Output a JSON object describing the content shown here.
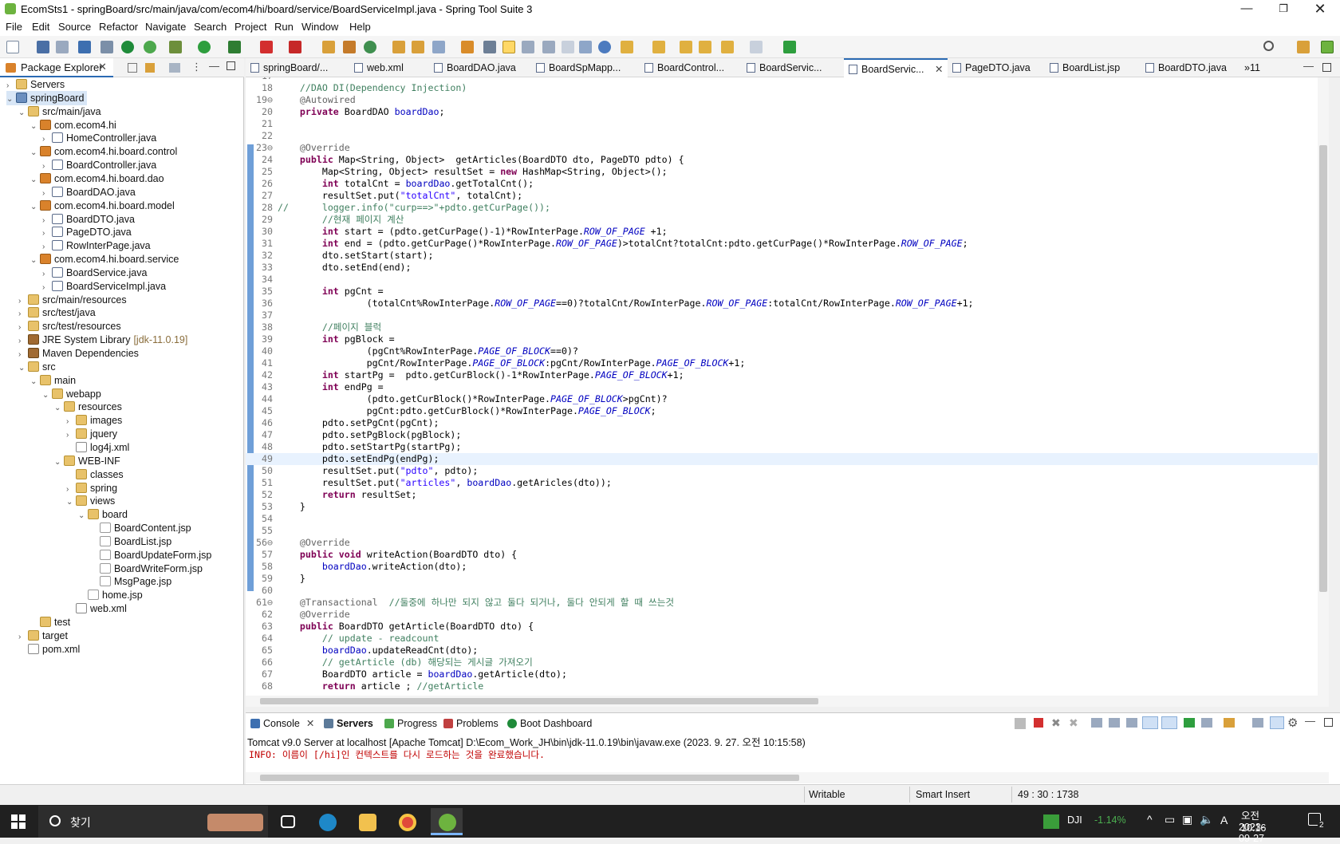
{
  "window": {
    "title": "EcomSts1 - springBoard/src/main/java/com/ecom4/hi/board/service/BoardServiceImpl.java - Spring Tool Suite 3"
  },
  "menu": [
    "File",
    "Edit",
    "Source",
    "Refactor",
    "Navigate",
    "Search",
    "Project",
    "Run",
    "Window",
    "Help"
  ],
  "package_explorer": {
    "title": "Package Explorer",
    "tree": [
      {
        "label": "Servers",
        "depth": 0,
        "icon": "folder",
        "arrow": "›"
      },
      {
        "label": "springBoard",
        "depth": 0,
        "icon": "project",
        "arrow": "⌄",
        "selected": true
      },
      {
        "label": "src/main/java",
        "depth": 1,
        "icon": "folder",
        "arrow": "⌄"
      },
      {
        "label": "com.ecom4.hi",
        "depth": 2,
        "icon": "pkg",
        "arrow": "⌄"
      },
      {
        "label": "HomeController.java",
        "depth": 3,
        "icon": "java",
        "arrow": "›"
      },
      {
        "label": "com.ecom4.hi.board.control",
        "depth": 2,
        "icon": "pkg",
        "arrow": "⌄"
      },
      {
        "label": "BoardController.java",
        "depth": 3,
        "icon": "java",
        "arrow": "›"
      },
      {
        "label": "com.ecom4.hi.board.dao",
        "depth": 2,
        "icon": "pkg",
        "arrow": "⌄"
      },
      {
        "label": "BoardDAO.java",
        "depth": 3,
        "icon": "java",
        "arrow": "›"
      },
      {
        "label": "com.ecom4.hi.board.model",
        "depth": 2,
        "icon": "pkg",
        "arrow": "⌄"
      },
      {
        "label": "BoardDTO.java",
        "depth": 3,
        "icon": "java",
        "arrow": "›"
      },
      {
        "label": "PageDTO.java",
        "depth": 3,
        "icon": "java",
        "arrow": "›"
      },
      {
        "label": "RowInterPage.java",
        "depth": 3,
        "icon": "java",
        "arrow": "›"
      },
      {
        "label": "com.ecom4.hi.board.service",
        "depth": 2,
        "icon": "pkg",
        "arrow": "⌄"
      },
      {
        "label": "BoardService.java",
        "depth": 3,
        "icon": "java",
        "arrow": "›"
      },
      {
        "label": "BoardServiceImpl.java",
        "depth": 3,
        "icon": "java",
        "arrow": "›"
      },
      {
        "label": "src/main/resources",
        "depth": 1,
        "icon": "folder",
        "arrow": "›"
      },
      {
        "label": "src/test/java",
        "depth": 1,
        "icon": "folder",
        "arrow": "›"
      },
      {
        "label": "src/test/resources",
        "depth": 1,
        "icon": "folder",
        "arrow": "›"
      },
      {
        "label": "JRE System Library",
        "suffix": "[jdk-11.0.19]",
        "depth": 1,
        "icon": "lib",
        "arrow": "›"
      },
      {
        "label": "Maven Dependencies",
        "depth": 1,
        "icon": "lib",
        "arrow": "›"
      },
      {
        "label": "src",
        "depth": 1,
        "icon": "folder",
        "arrow": "⌄"
      },
      {
        "label": "main",
        "depth": 2,
        "icon": "folder",
        "arrow": "⌄"
      },
      {
        "label": "webapp",
        "depth": 3,
        "icon": "folder",
        "arrow": "⌄"
      },
      {
        "label": "resources",
        "depth": 4,
        "icon": "folder",
        "arrow": "⌄"
      },
      {
        "label": "images",
        "depth": 5,
        "icon": "folder",
        "arrow": "›"
      },
      {
        "label": "jquery",
        "depth": 5,
        "icon": "folder",
        "arrow": "›"
      },
      {
        "label": "log4j.xml",
        "depth": 5,
        "icon": "xml",
        "arrow": ""
      },
      {
        "label": "WEB-INF",
        "depth": 4,
        "icon": "folder",
        "arrow": "⌄"
      },
      {
        "label": "classes",
        "depth": 5,
        "icon": "folder",
        "arrow": ""
      },
      {
        "label": "spring",
        "depth": 5,
        "icon": "folder",
        "arrow": "›"
      },
      {
        "label": "views",
        "depth": 5,
        "icon": "folder",
        "arrow": "⌄"
      },
      {
        "label": "board",
        "depth": 6,
        "icon": "folder",
        "arrow": "⌄"
      },
      {
        "label": "BoardContent.jsp",
        "depth": 7,
        "icon": "jsp",
        "arrow": ""
      },
      {
        "label": "BoardList.jsp",
        "depth": 7,
        "icon": "jsp",
        "arrow": ""
      },
      {
        "label": "BoardUpdateForm.jsp",
        "depth": 7,
        "icon": "jsp",
        "arrow": ""
      },
      {
        "label": "BoardWriteForm.jsp",
        "depth": 7,
        "icon": "jsp",
        "arrow": ""
      },
      {
        "label": "MsgPage.jsp",
        "depth": 7,
        "icon": "jsp",
        "arrow": ""
      },
      {
        "label": "home.jsp",
        "depth": 6,
        "icon": "jsp",
        "arrow": ""
      },
      {
        "label": "web.xml",
        "depth": 5,
        "icon": "xml",
        "arrow": ""
      },
      {
        "label": "test",
        "depth": 2,
        "icon": "folder",
        "arrow": ""
      },
      {
        "label": "target",
        "depth": 1,
        "icon": "folder",
        "arrow": "›"
      },
      {
        "label": "pom.xml",
        "depth": 1,
        "icon": "xml",
        "arrow": ""
      }
    ]
  },
  "editor_tabs": [
    {
      "label": "springBoard/..."
    },
    {
      "label": "web.xml"
    },
    {
      "label": "BoardDAO.java"
    },
    {
      "label": "BoardSpMapp..."
    },
    {
      "label": "BoardControl..."
    },
    {
      "label": "BoardServic..."
    },
    {
      "label": "BoardServic...",
      "active": true
    },
    {
      "label": "PageDTO.java"
    },
    {
      "label": "BoardList.jsp"
    },
    {
      "label": "BoardDTO.java"
    },
    {
      "label": "»11"
    }
  ],
  "code_lines": [
    {
      "n": "17",
      "t": ""
    },
    {
      "n": "18",
      "t": "    //DAO DI(Dependency Injection)"
    },
    {
      "n": "19⊖",
      "t": "    @Autowired"
    },
    {
      "n": "20",
      "t": "    private BoardDAO boardDao;"
    },
    {
      "n": "21",
      "t": ""
    },
    {
      "n": "22",
      "t": ""
    },
    {
      "n": "23⊖",
      "t": "    @Override"
    },
    {
      "n": "24",
      "t": "    public Map<String, Object>  getArticles(BoardDTO dto, PageDTO pdto) {"
    },
    {
      "n": "25",
      "t": "        Map<String, Object> resultSet = new HashMap<String, Object>();"
    },
    {
      "n": "26",
      "t": "        int totalCnt = boardDao.getTotalCnt();"
    },
    {
      "n": "27",
      "t": "        resultSet.put(\"totalCnt\", totalCnt);"
    },
    {
      "n": "28",
      "t": "//      logger.info(\"curp==>\"+pdto.getCurPage());"
    },
    {
      "n": "29",
      "t": "        //현재 페이지 계산"
    },
    {
      "n": "30",
      "t": "        int start = (pdto.getCurPage()-1)*RowInterPage.ROW_OF_PAGE +1;"
    },
    {
      "n": "31",
      "t": "        int end = (pdto.getCurPage()*RowInterPage.ROW_OF_PAGE)>totalCnt?totalCnt:pdto.getCurPage()*RowInterPage.ROW_OF_PAGE;"
    },
    {
      "n": "32",
      "t": "        dto.setStart(start);"
    },
    {
      "n": "33",
      "t": "        dto.setEnd(end);"
    },
    {
      "n": "34",
      "t": ""
    },
    {
      "n": "35",
      "t": "        int pgCnt ="
    },
    {
      "n": "36",
      "t": "                (totalCnt%RowInterPage.ROW_OF_PAGE==0)?totalCnt/RowInterPage.ROW_OF_PAGE:totalCnt/RowInterPage.ROW_OF_PAGE+1;"
    },
    {
      "n": "37",
      "t": ""
    },
    {
      "n": "38",
      "t": "        //페이지 블럭"
    },
    {
      "n": "39",
      "t": "        int pgBlock ="
    },
    {
      "n": "40",
      "t": "                (pgCnt%RowInterPage.PAGE_OF_BLOCK==0)?"
    },
    {
      "n": "41",
      "t": "                pgCnt/RowInterPage.PAGE_OF_BLOCK:pgCnt/RowInterPage.PAGE_OF_BLOCK+1;"
    },
    {
      "n": "42",
      "t": "        int startPg =  pdto.getCurBlock()-1*RowInterPage.PAGE_OF_BLOCK+1;"
    },
    {
      "n": "43",
      "t": "        int endPg ="
    },
    {
      "n": "44",
      "t": "                (pdto.getCurBlock()*RowInterPage.PAGE_OF_BLOCK>pgCnt)?"
    },
    {
      "n": "45",
      "t": "                pgCnt:pdto.getCurBlock()*RowInterPage.PAGE_OF_BLOCK;"
    },
    {
      "n": "46",
      "t": "        pdto.setPgCnt(pgCnt);"
    },
    {
      "n": "47",
      "t": "        pdto.setPgBlock(pgBlock);"
    },
    {
      "n": "48",
      "t": "        pdto.setStartPg(startPg);"
    },
    {
      "n": "49",
      "t": "        pdto.setEndPg(endPg);",
      "current": true
    },
    {
      "n": "50",
      "t": "        resultSet.put(\"pdto\", pdto);"
    },
    {
      "n": "51",
      "t": "        resultSet.put(\"articles\", boardDao.getAricles(dto));"
    },
    {
      "n": "52",
      "t": "        return resultSet;"
    },
    {
      "n": "53",
      "t": "    }"
    },
    {
      "n": "54",
      "t": ""
    },
    {
      "n": "55",
      "t": ""
    },
    {
      "n": "56⊖",
      "t": "    @Override"
    },
    {
      "n": "57",
      "t": "    public void writeAction(BoardDTO dto) {"
    },
    {
      "n": "58",
      "t": "        boardDao.writeAction(dto);"
    },
    {
      "n": "59",
      "t": "    }"
    },
    {
      "n": "60",
      "t": ""
    },
    {
      "n": "61⊖",
      "t": "    @Transactional  //둘중에 하나만 되지 않고 둘다 되거나, 둘다 안되게 할 때 쓰는것"
    },
    {
      "n": "62",
      "t": "    @Override"
    },
    {
      "n": "63",
      "t": "    public BoardDTO getArticle(BoardDTO dto) {"
    },
    {
      "n": "64",
      "t": "        // update - readcount"
    },
    {
      "n": "65",
      "t": "        boardDao.updateReadCnt(dto);"
    },
    {
      "n": "66",
      "t": "        // getArticle (db) 해당되는 게시글 가져오기"
    },
    {
      "n": "67",
      "t": "        BoardDTO article = boardDao.getArticle(dto);"
    },
    {
      "n": "68",
      "t": "        return article ; //getArticle"
    }
  ],
  "console": {
    "tabs": [
      "Console",
      "Servers",
      "Progress",
      "Problems",
      "Boot Dashboard"
    ],
    "active_tab": "Servers",
    "server_info": "Tomcat v9.0 Server at localhost [Apache Tomcat] D:\\Ecom_Work_JH\\bin\\jdk-11.0.19\\bin\\javaw.exe  (2023. 9. 27. 오전 10:15:58)",
    "output": "INFO: 이름이 [/hi]인 컨텍스트를 다시 로드하는 것을 완료했습니다."
  },
  "status": {
    "writable": "Writable",
    "insert_mode": "Smart Insert",
    "position": "49 : 30 : 1738"
  },
  "taskbar": {
    "search_placeholder": "찾기",
    "stock_name": "DJI",
    "stock_change": "-1.14%",
    "time": "오전 10:16",
    "date": "2023-09-27",
    "notifications": "2",
    "lang": "A"
  },
  "colors": {
    "accent": "#2a6ab3",
    "keyword": "#7f0055",
    "comment": "#3f7f5f",
    "string": "#2a00ff",
    "field": "#0000c0"
  }
}
